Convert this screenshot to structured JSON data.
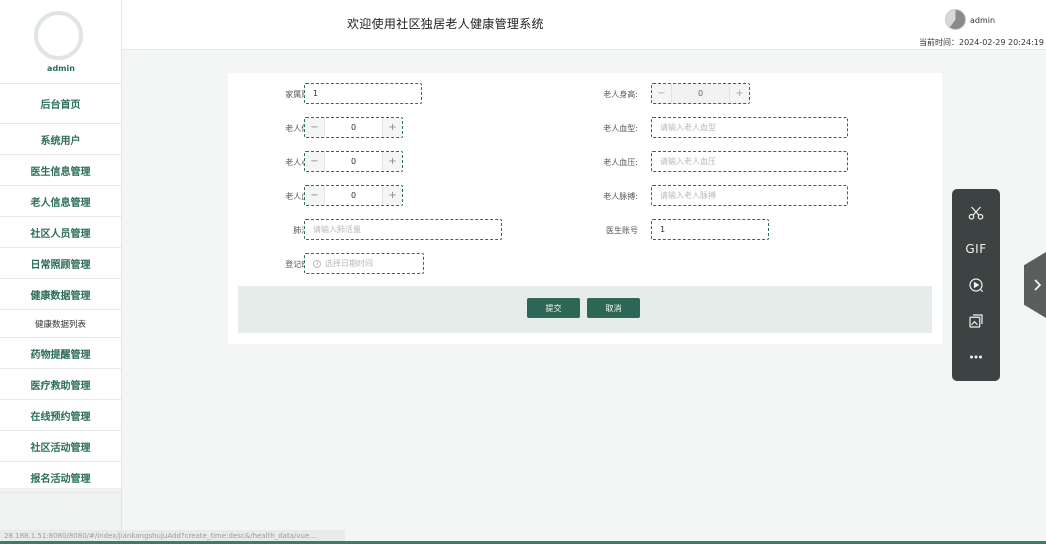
{
  "sidebar": {
    "user": "admin",
    "items": [
      {
        "label": "后台首页"
      },
      {
        "label": "系统用户"
      },
      {
        "label": "医生信息管理"
      },
      {
        "label": "老人信息管理"
      },
      {
        "label": "社区人员管理"
      },
      {
        "label": "日常照顾管理"
      },
      {
        "label": "健康数据管理"
      },
      {
        "label": "健康数据列表"
      },
      {
        "label": "药物提醒管理"
      },
      {
        "label": "医疗救助管理"
      },
      {
        "label": "在线预约管理"
      },
      {
        "label": "社区活动管理"
      },
      {
        "label": "报名活动管理"
      }
    ]
  },
  "header": {
    "title": "欢迎使用社区独居老人健康管理系统",
    "user": "admin",
    "time": "当前时间：2024-02-29 20:24:19"
  },
  "form": {
    "account_label": "家属账号:",
    "account_value": "1",
    "height_label": "老人身高:",
    "height_value": "0",
    "weight_label": "老人体重:",
    "weight_value": "0",
    "bloodtype_label": "老人血型:",
    "bloodtype_placeholder": "请输入老人血型",
    "heartrate_label": "老人心率:",
    "heartrate_value": "0",
    "pressure_label": "老人血压:",
    "pressure_placeholder": "请输入老人血压",
    "sugar_label": "老人血糖:",
    "sugar_value": "0",
    "pulse_label": "老人脉搏:",
    "pulse_placeholder": "请输入老人脉搏",
    "lung_label": "肺活量:",
    "lung_placeholder": "请输入肺活量",
    "doctor_label": "医生账号",
    "doctor_value": "1",
    "time_label": "登记时间:",
    "time_placeholder": "选择日期时间",
    "submit": "提交",
    "cancel": "取消"
  },
  "toolbar": {
    "gif_label": "GIF",
    "icons": [
      "scissors-icon",
      "gif-icon",
      "screen-record-icon",
      "image-icon",
      "more-icon"
    ]
  },
  "status_bar": {
    "url": "28.188.1.51:8080/8080/#/index/jiankangshujuAdd?create_time:desc&/health_data/vue..."
  },
  "colors": {
    "accent": "#2d6654",
    "accent_text": "#2c6e5a",
    "toolbar_bg": "#3d4342"
  }
}
